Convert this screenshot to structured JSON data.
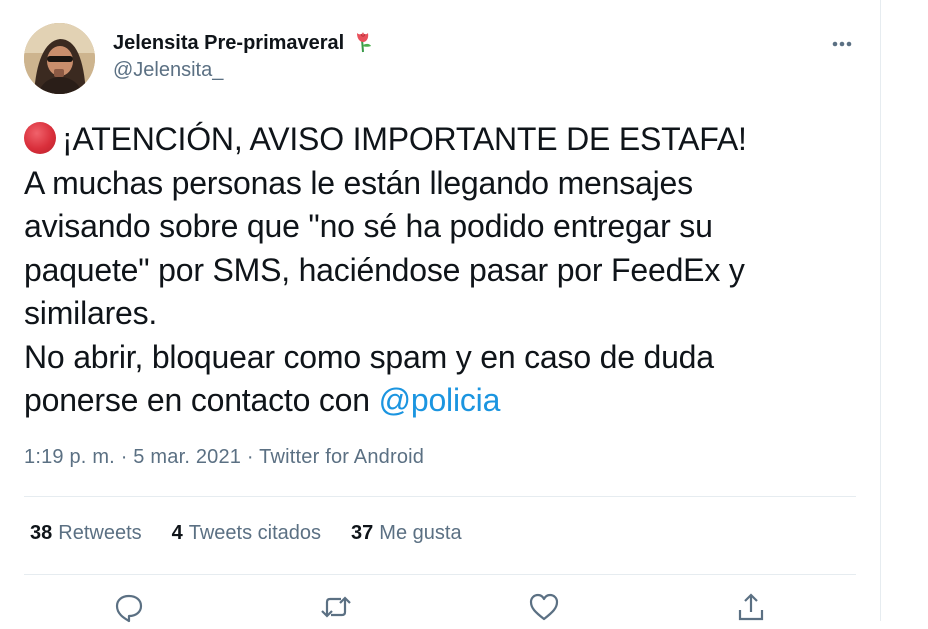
{
  "user": {
    "display_name": "Jelensita Pre-primaveral",
    "name_emoji": "rose-icon",
    "handle": "@Jelensita_",
    "avatar": "avatar"
  },
  "tweet": {
    "emoji": "red-circle-icon",
    "lines": [
      "¡ATENCIÓN, AVISO IMPORTANTE DE ESTAFA!",
      "A muchas personas le están llegando mensajes",
      "avisando sobre que \"no sé ha podido entregar su",
      "paquete\" por SMS, haciéndose pasar por FeedEx y",
      "similares.",
      "No abrir, bloquear como spam y en caso de duda",
      "ponerse en contacto con "
    ],
    "mention": "@policia"
  },
  "meta": {
    "text": "1:19 p. m. · 5 mar. 2021 · Twitter for Android"
  },
  "stats": {
    "retweets_count": "38",
    "retweets_label": "Retweets",
    "quotes_count": "4",
    "quotes_label": "Tweets citados",
    "likes_count": "37",
    "likes_label": "Me gusta"
  },
  "actions": [
    "reply-icon",
    "retweet-icon",
    "like-icon",
    "share-icon"
  ],
  "colors": {
    "text": "#0f1419",
    "secondary": "#5b7083",
    "link": "#1b95e0",
    "divider": "#e6ecf0"
  }
}
